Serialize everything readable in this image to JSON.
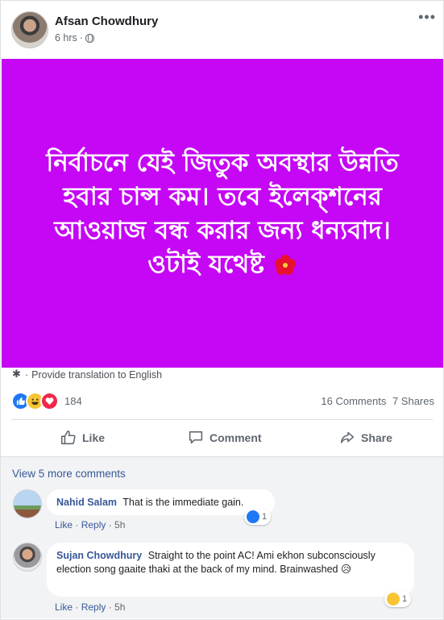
{
  "post": {
    "author": "Afsan Chowdhury",
    "time": "6 hrs",
    "privacy_icon": "globe-icon",
    "more_icon": "ellipsis-icon",
    "image_bg": "#c507f5",
    "image_text": "নির্বাচনে যেই জিতুক অবস্থার উন্নতি হবার চান্স কম। তবে ইলেক্শনের আওয়াজ বন্ধ করার জন্য ধন্যবাদ। ওটাই যথেষ্ট",
    "image_emoji": "hibiscus-icon"
  },
  "translation": {
    "label": "Provide translation to English"
  },
  "reactions": {
    "types": [
      "like",
      "haha",
      "love"
    ],
    "count": "184"
  },
  "stats": {
    "comments": "16 Comments",
    "shares": "7 Shares"
  },
  "actions": {
    "like": "Like",
    "comment": "Comment",
    "share": "Share"
  },
  "comments": {
    "view_more": "View 5 more comments",
    "items": [
      {
        "name": "Nahid Salam",
        "text": "That is the immediate gain.",
        "like_label": "Like",
        "reply_label": "Reply",
        "time": "5h",
        "reaction": "like",
        "reaction_count": "1"
      },
      {
        "name": "Sujan Chowdhury",
        "text": "Straight to the point AC! Ami ekhon subconsciously election song gaaite thaki at the back of my mind. Brainwashed 😥",
        "like_label": "Like",
        "reply_label": "Reply",
        "time": "5h",
        "reaction": "haha",
        "reaction_count": "1"
      }
    ]
  },
  "colors": {
    "link": "#385898",
    "accent": "#2078f4",
    "muted": "#606770"
  }
}
